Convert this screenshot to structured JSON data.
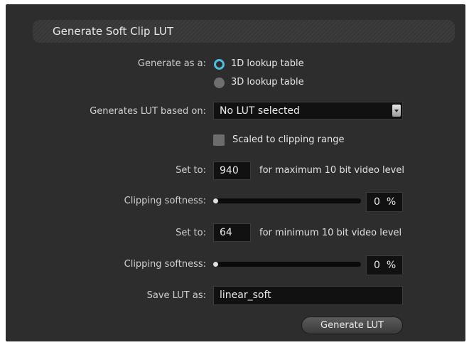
{
  "title": "Generate Soft Clip LUT",
  "generate_as": {
    "label": "Generate as a:",
    "options": [
      {
        "label": "1D lookup table",
        "selected": true
      },
      {
        "label": "3D lookup table",
        "selected": false
      }
    ]
  },
  "based_on": {
    "label": "Generates LUT based on:",
    "value": "No LUT selected"
  },
  "scaled": {
    "label": "Scaled to clipping range",
    "checked": false
  },
  "max": {
    "set_label": "Set to:",
    "value": "940",
    "note": "for maximum 10 bit video level",
    "softness_label": "Clipping softness:",
    "softness_value": "0",
    "softness_unit": "%"
  },
  "min": {
    "set_label": "Set to:",
    "value": "64",
    "note": "for minimum 10 bit video level",
    "softness_label": "Clipping softness:",
    "softness_value": "0",
    "softness_unit": "%"
  },
  "save": {
    "label": "Save LUT as:",
    "value": "linear_soft"
  },
  "button": {
    "label": "Generate LUT"
  },
  "colors": {
    "panel": "#2d2d2d",
    "accent": "#49c1de"
  }
}
